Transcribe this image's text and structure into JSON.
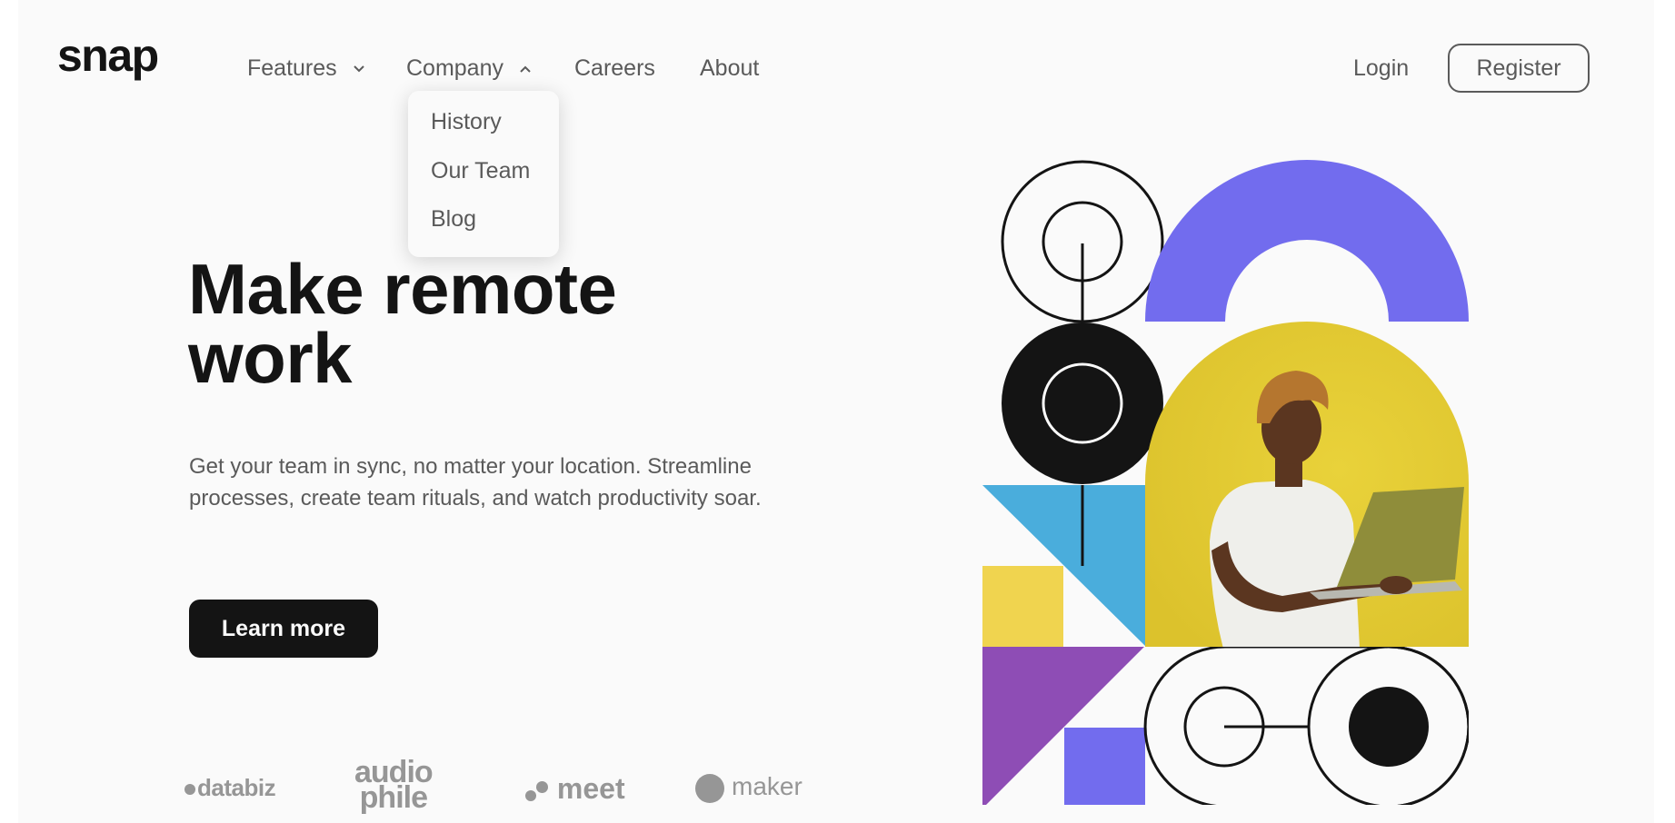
{
  "brand": {
    "logo_text": "snap"
  },
  "nav": {
    "items": [
      {
        "label": "Features",
        "chevron": "chevron-down-icon"
      },
      {
        "label": "Company",
        "chevron": "chevron-up-icon"
      },
      {
        "label": "Careers"
      },
      {
        "label": "About"
      }
    ],
    "login_label": "Login",
    "register_label": "Register"
  },
  "company_dropdown": {
    "items": [
      "History",
      "Our Team",
      "Blog"
    ]
  },
  "hero": {
    "title_line1": "Make remote",
    "title_line2": "work",
    "description": "Get your team in sync, no matter your location. Streamline processes, create team rituals, and watch productivity soar.",
    "cta_label": "Learn more"
  },
  "clients": {
    "databiz": "databiz",
    "audiophile_line1": "audio",
    "audiophile_line2": "phile",
    "meet": "meet",
    "maker": "maker"
  },
  "colors": {
    "background": "#fafafa",
    "text_dark": "#141414",
    "text_medium": "#5a5a5a",
    "client_gray": "#969696",
    "accent_purple": "#726cee",
    "accent_yellow": "#f0d44f",
    "accent_blue": "#4aaddc",
    "accent_violet": "#8e4db5"
  }
}
